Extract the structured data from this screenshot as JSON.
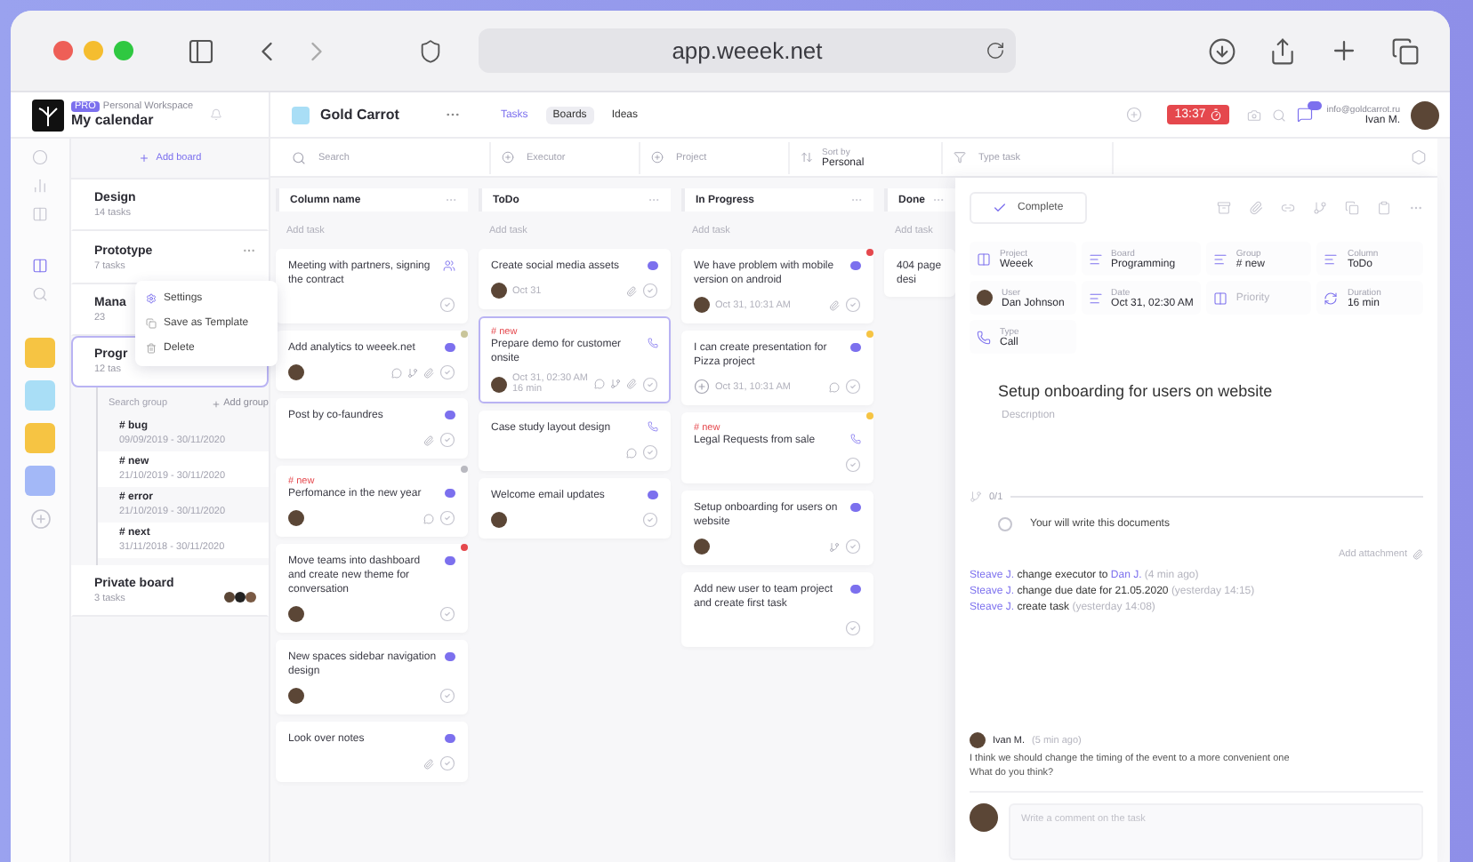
{
  "browser": {
    "address": "app.weeek.net"
  },
  "workspace": {
    "badge": "PRO",
    "caption": "Personal Workspace",
    "name": "My calendar"
  },
  "project": {
    "name": "Gold Carrot"
  },
  "header_tabs": [
    {
      "label": "Tasks",
      "selected": true,
      "hovered": false
    },
    {
      "label": "Boards",
      "selected": false,
      "hovered": true
    },
    {
      "label": "Ideas",
      "selected": false,
      "hovered": false
    }
  ],
  "timer": "13:37",
  "user": {
    "email": "info@goldcarrot.ru",
    "name": "Ivan M."
  },
  "rail_projects": [
    {
      "color": "#f6c443"
    },
    {
      "color": "#a9def6"
    },
    {
      "color": "#f6c443"
    },
    {
      "color": "#a3b8f7"
    }
  ],
  "boards_panel": {
    "add_label": "Add board",
    "boards": [
      {
        "name": "Design",
        "count": "14 tasks",
        "selected": false
      },
      {
        "name": "Prototype",
        "count": "7 tasks",
        "selected": false
      },
      {
        "name": "Mana",
        "count": "23",
        "selected": false
      },
      {
        "name": "Progr",
        "count": "12 tas",
        "selected": true,
        "group_search": "Search group",
        "add_group": "Add group",
        "groups": [
          {
            "name": "# bug",
            "dates": "09/09/2019 - 30/11/2020"
          },
          {
            "name": "# new",
            "dates": "21/10/2019 - 30/11/2020"
          },
          {
            "name": "# error",
            "dates": "21/10/2019 - 30/11/2020"
          },
          {
            "name": "# next",
            "dates": "31/11/2018 - 30/11/2020"
          }
        ]
      },
      {
        "name": "Private board",
        "count": "3 tasks",
        "selected": false
      }
    ]
  },
  "context_menu": [
    "Settings",
    "Save as Template",
    "Delete"
  ],
  "filters": [
    {
      "kind": "search",
      "placeholder": "Search"
    },
    {
      "kind": "select",
      "placeholder": "Executor"
    },
    {
      "kind": "select",
      "placeholder": "Project"
    },
    {
      "kind": "sort",
      "label": "Sort by",
      "value": "Personal"
    },
    {
      "kind": "type",
      "placeholder": "Type task"
    }
  ],
  "columns": [
    {
      "name": "Column name",
      "add_label": "Add task",
      "cards": [
        {
          "title": "Meeting with partners, signing the contract",
          "kind": "meeting",
          "selected": false
        },
        {
          "title": "Add analytics to weeek.net",
          "kind": "task",
          "color": "#c9c59a",
          "selected": false
        },
        {
          "title": "Post by co-faundres",
          "kind": "task",
          "selected": false
        },
        {
          "tag": "# new",
          "title": "Perfomance in the new year",
          "kind": "task",
          "color": "#b9b9c0",
          "selected": false
        },
        {
          "title": "Move teams into dashboard and create new theme for conversation",
          "kind": "task",
          "color": "#e5484d",
          "selected": false
        },
        {
          "title": "New spaces sidebar navigation design",
          "kind": "task",
          "selected": false
        },
        {
          "title": "Look over notes",
          "kind": "task",
          "selected": false
        }
      ]
    },
    {
      "name": "ToDo",
      "add_label": "Add task",
      "cards": [
        {
          "title": "Create social media assets",
          "kind": "task",
          "meta": "Oct 31",
          "selected": false
        },
        {
          "tag": "# new",
          "title": "Prepare demo for customer onsite",
          "kind": "call",
          "meta": "Oct 31, 02:30 AM 16 min",
          "selected": true
        },
        {
          "title": "Case study layout design",
          "kind": "call",
          "selected": false
        },
        {
          "title": "Welcome email updates",
          "kind": "task",
          "selected": false
        }
      ]
    },
    {
      "name": "In Progress",
      "add_label": "Add task",
      "cards": [
        {
          "title": "We have problem with mobile version on android",
          "kind": "task",
          "meta": "Oct 31, 10:31 AM",
          "color": "#e5484d",
          "selected": false
        },
        {
          "title": "I can create presentation for Pizza project",
          "kind": "task",
          "meta": "Oct 31, 10:31 AM",
          "color": "#f6c443",
          "selected": false
        },
        {
          "tag": "# new",
          "title": "Legal Requests from sale",
          "kind": "call",
          "color": "#f6c443",
          "selected": false
        },
        {
          "title": "Setup onboarding for users on website",
          "kind": "task",
          "selected": false
        },
        {
          "title": "Add new user to team project and create first task",
          "kind": "task",
          "selected": false
        }
      ]
    },
    {
      "name": "Done",
      "add_label": "Add task",
      "cards": [
        {
          "title": "404 page desi",
          "kind": "plain",
          "selected": false
        }
      ]
    }
  ],
  "task_panel": {
    "complete_label": "Complete",
    "properties": [
      {
        "label": "Project",
        "value": "Weeek"
      },
      {
        "label": "Board",
        "value": "Programming"
      },
      {
        "label": "Group",
        "value": "# new"
      },
      {
        "label": "Column",
        "value": "ToDo"
      },
      {
        "label": "User",
        "value": "Dan Johnson"
      },
      {
        "label": "Date",
        "value": "Oct 31, 02:30 AM"
      },
      {
        "placeholder": "Priority"
      },
      {
        "label": "Duration",
        "value": "16 min"
      },
      {
        "label": "Type",
        "value": "Call"
      }
    ],
    "title": "Setup onboarding for users on website",
    "description_placeholder": "Description",
    "subtasks_count": "0/1",
    "subtasks": [
      {
        "title": "Your will write this documents",
        "checked": false
      }
    ],
    "add_attachment": "Add attachment",
    "activity": [
      {
        "actor": "Steave J.",
        "action": "change executor to",
        "target": "Dan J.",
        "time": "(4 min ago)"
      },
      {
        "actor": "Steave J.",
        "action": "change due date for 21.05.2020",
        "time": "(yesterday 14:15)"
      },
      {
        "actor": "Steave J.",
        "action": "create task",
        "time": "(yesterday 14:08)"
      }
    ],
    "comment": {
      "author": "Ivan M.",
      "time": "(5 min ago)",
      "lines": [
        "I think we should change the timing of the event to a more convenient one",
        "What do you think?"
      ]
    },
    "comment_placeholder": "Write a comment on the task"
  }
}
